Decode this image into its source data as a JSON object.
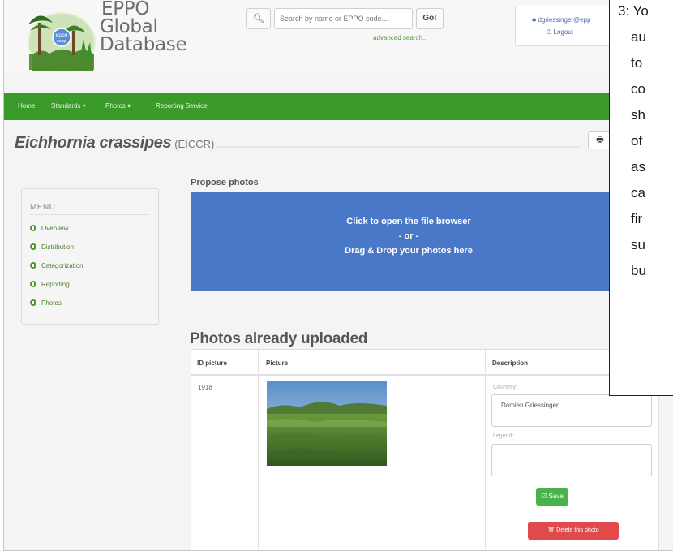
{
  "logo": {
    "line1": "EPPO",
    "line2": "Global",
    "line3": "Database",
    "badge": "eppo",
    "badge_sub": "oepp"
  },
  "search": {
    "placeholder": "Search by name or EPPO code...",
    "go_label": "Go!",
    "advanced_label": "advanced search..."
  },
  "user": {
    "email": "♣ dgriessinger@epp",
    "logout": "⏻ Logout"
  },
  "nav": {
    "items": [
      "Home",
      "Standards ▾",
      "Photos ▾",
      "Reporting Service"
    ]
  },
  "species": {
    "name": "Eichhornia crassipes",
    "code": "(EICCR)"
  },
  "menu": {
    "title": "MENU",
    "items": [
      "Overview",
      "Distribution",
      "Categorization",
      "Reporting",
      "Photos"
    ]
  },
  "propose": {
    "title": "Propose photos",
    "line1": "Click to open the file browser",
    "line2": "- or -",
    "line3": "Drag & Drop your photos here"
  },
  "uploaded": {
    "title": "Photos already uploaded",
    "headers": [
      "ID picture",
      "Picture",
      "Description"
    ],
    "row": {
      "id": "1918",
      "courtesy_label": "Courtesy:",
      "courtesy_value": "Damien Griessinger",
      "legend_label": "Legend:",
      "save_label": "☑ Save",
      "delete_label": "🗑 Delete this photo"
    }
  },
  "callout": {
    "lines": [
      "3: Yo",
      "au",
      "to",
      "co",
      "sh",
      "of",
      "as",
      "ca",
      "fir",
      "su",
      "bu"
    ]
  },
  "colors": {
    "nav_green": "#3a9a2a",
    "dropzone_blue": "#4a78c9",
    "save_green": "#49b24a",
    "delete_red": "#e04a4a"
  }
}
